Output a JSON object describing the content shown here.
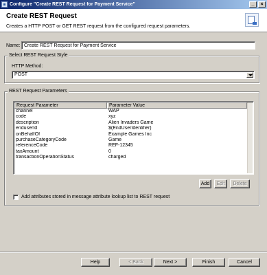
{
  "window": {
    "title": "Configure \"Create REST Request for Payment Service\"",
    "minimize": "_",
    "close": "×"
  },
  "header": {
    "title": "Create REST Request",
    "description": "Creates a HTTP POST or GET REST request from the configured request parameters."
  },
  "name": {
    "label": "Name:",
    "value": "Create REST Request for Payment Service"
  },
  "style_group": {
    "legend": "Select REST Request Style",
    "http_method_label": "HTTP Method:",
    "http_method_value": "POST"
  },
  "params_group": {
    "legend": "REST Request Parameters",
    "columns": [
      "Request Parameter",
      "Parameter Value"
    ],
    "rows": [
      [
        "channel",
        "WAP"
      ],
      [
        "code",
        "xyz"
      ],
      [
        "description",
        "Alien Invaders Game"
      ],
      [
        "enduserId",
        "$(EndUserIdentifier)"
      ],
      [
        "onBehalfOf",
        "Example Games Inc"
      ],
      [
        "purchaseCategoryCode",
        "Game"
      ],
      [
        "referenceCode",
        "REF-12345"
      ],
      [
        "taxAmount",
        "0"
      ],
      [
        "transactionOperationStatus",
        "charged"
      ]
    ],
    "add_label": "Add",
    "edit_label": "Edit",
    "delete_label": "Delete",
    "checkbox_label": "Add attributes stored in message attribute lookup list to REST request"
  },
  "footer": {
    "help": "Help",
    "back": "< Back",
    "next": "Next >",
    "finish": "Finish",
    "cancel": "Cancel"
  }
}
